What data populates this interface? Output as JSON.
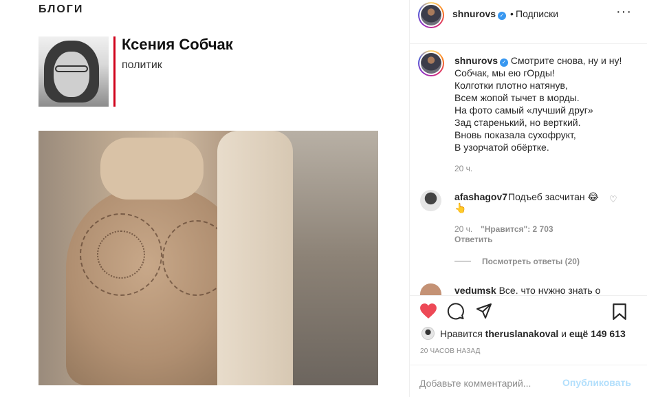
{
  "media": {
    "section_label": "БЛОГИ",
    "author_name": "Ксения Собчак",
    "author_role": "политик"
  },
  "header": {
    "username": "shnurovs",
    "verified_icon": "verified-badge-icon",
    "dot": "•",
    "follow_label": "Подписки",
    "more_icon": "more-options-icon"
  },
  "caption": {
    "username": "shnurovs",
    "lines": [
      "Смотрите снова, ну и ну!",
      "Собчак, мы ею гОрды!",
      "Колготки плотно натянув,",
      "Всем жопой тычет в морды.",
      "На фото самый «лучший друг»",
      "Зад старенький, но верткий.",
      "Вновь показала сухофрукт,",
      "В узорчатой обёртке."
    ],
    "time": "20 ч."
  },
  "comments": [
    {
      "username": "afashagov7",
      "text": "Подъеб засчитан 😂",
      "text2": "👆",
      "time": "20 ч.",
      "likes": "\"Нравится\": 2 703",
      "reply": "Ответить",
      "view_replies": "Посмотреть ответы (20)"
    },
    {
      "username": "vedumsk",
      "text": "Все, что нужно знать о"
    }
  ],
  "actions": {
    "like_icon": "heart-filled-icon",
    "comment_icon": "comment-icon",
    "share_icon": "share-icon",
    "save_icon": "bookmark-icon",
    "likes_prefix": "Нравится",
    "likes_user": "theruslanakoval",
    "likes_mid": "и",
    "likes_count": "ещё 149 613",
    "post_time": "20 ЧАСОВ НАЗАД",
    "comment_placeholder": "Добавьте комментарий...",
    "publish_label": "Опубликовать"
  },
  "colors": {
    "like_red": "#ed4956",
    "verified_blue": "#3897f0",
    "publish_disabled": "#b2dffc",
    "accent_bar": "#d0021b"
  }
}
